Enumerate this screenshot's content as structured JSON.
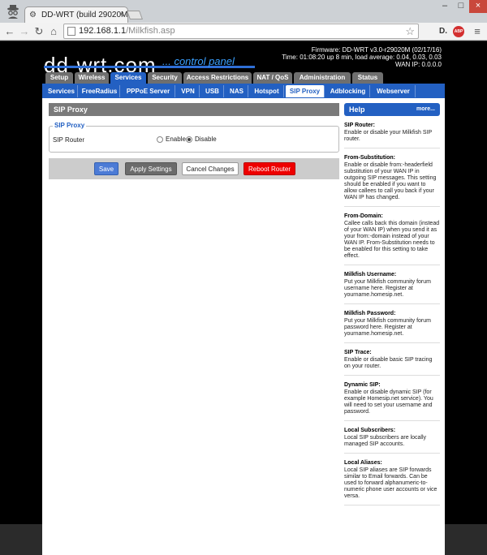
{
  "browser": {
    "tab_title": "DD-WRT (build 29020M)",
    "tab_close": "×",
    "url_host": "192.168.1.1",
    "url_path": "/Milkfish.asp",
    "ext1": "D.",
    "ext2": "ABP",
    "win_min": "–",
    "win_max": "□",
    "win_close": "×"
  },
  "header": {
    "logo": "dd-wrt.com",
    "subtitle": "... control panel",
    "firmware": "Firmware: DD-WRT v3.0-r29020M (02/17/16)",
    "time": "Time: 01:08:20 up 8 min, load average: 0.04, 0.03, 0.03",
    "wan_ip": "WAN IP: 0.0.0.0"
  },
  "main_tabs": [
    {
      "label": "Setup"
    },
    {
      "label": "Wireless"
    },
    {
      "label": "Services"
    },
    {
      "label": "Security"
    },
    {
      "label": "Access Restrictions"
    },
    {
      "label": "NAT / QoS"
    },
    {
      "label": "Administration"
    },
    {
      "label": "Status"
    }
  ],
  "sub_tabs": [
    {
      "label": "Services"
    },
    {
      "label": "FreeRadius"
    },
    {
      "label": "PPPoE Server"
    },
    {
      "label": "VPN"
    },
    {
      "label": "USB"
    },
    {
      "label": "NAS"
    },
    {
      "label": "Hotspot"
    },
    {
      "label": "SIP Proxy"
    },
    {
      "label": "Adblocking"
    },
    {
      "label": "Webserver"
    }
  ],
  "section": {
    "title": "SIP Proxy",
    "legend": "SIP Proxy",
    "field_label": "SIP Router",
    "enable_label": "Enable",
    "disable_label": "Disable"
  },
  "buttons": {
    "save": "Save",
    "apply": "Apply Settings",
    "cancel": "Cancel Changes",
    "reboot": "Reboot Router"
  },
  "help": {
    "title": "Help",
    "more": "more...",
    "items": [
      {
        "title": "SIP Router:",
        "text": "Enable or disable your Milkfish SIP router."
      },
      {
        "title": "From-Substitution:",
        "text": "Enable or disable from:-headerfield substitution of your WAN IP in outgoing SIP messages. This setting should be enabled if you want to allow callees to call you back if your WAN IP has changed."
      },
      {
        "title": "From-Domain:",
        "text": "Callee calls back this domain (instead of your WAN IP) when you send it as your from:-domain instead of your WAN IP. From-Substitution needs to be enabled for this setting to take effect."
      },
      {
        "title": "Milkfish Username:",
        "text": "Put your Milkfish community forum username here. Register at yourname.homesip.net."
      },
      {
        "title": "Milkfish Password:",
        "text": "Put your Milkfish community forum password here. Register at yourname.homesip.net."
      },
      {
        "title": "SIP Trace:",
        "text": "Enable or disable basic SIP tracing on your router."
      },
      {
        "title": "Dynamic SIP:",
        "text": "Enable or disable dynamic SIP (for example Homesip.net service). You will need to set your username and password."
      },
      {
        "title": "Local Subscribers:",
        "text": "Local SIP subscribers are locally managed SIP accounts."
      },
      {
        "title": "Local Aliases:",
        "text": "Local SIP aliases are SIP forwards similar to Email forwards. Can be used to forward alphanumeric-to-numeric phone user accounts or vice versa."
      }
    ]
  }
}
